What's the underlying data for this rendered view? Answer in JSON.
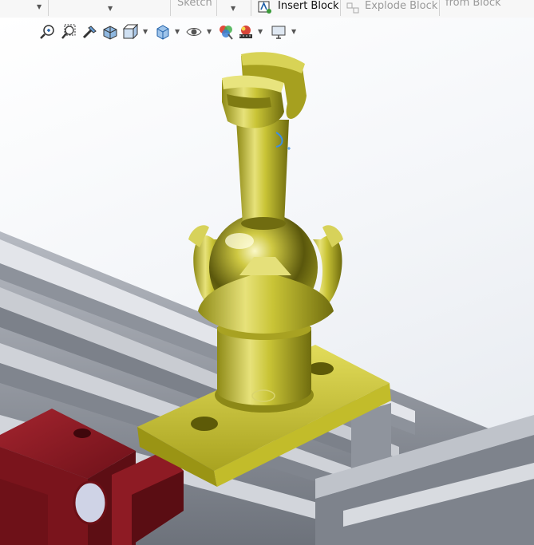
{
  "ribbon": {
    "sketch_label": "Sketch",
    "insert_block_label": "Insert Block",
    "explode_block_label": "Explode Block",
    "from_block_label": "from Block"
  },
  "heads_up_toolbar": {
    "tools": [
      {
        "icon": "zoom-to-fit-icon"
      },
      {
        "icon": "zoom-to-area-icon"
      },
      {
        "icon": "previous-view-icon"
      },
      {
        "icon": "section-view-icon"
      },
      {
        "icon": "view-orientation-icon"
      },
      {
        "icon": "display-style-icon"
      },
      {
        "icon": "hide-show-items-icon"
      },
      {
        "icon": "edit-appearance-icon"
      },
      {
        "icon": "apply-scene-icon"
      },
      {
        "icon": "view-settings-icon"
      }
    ]
  },
  "colors": {
    "part_yellow": "#c8c233",
    "part_red": "#8a1a22",
    "rail_gray": "#a9adb5",
    "background_top": "#ffffff",
    "background_bottom": "#e4e8ee"
  }
}
